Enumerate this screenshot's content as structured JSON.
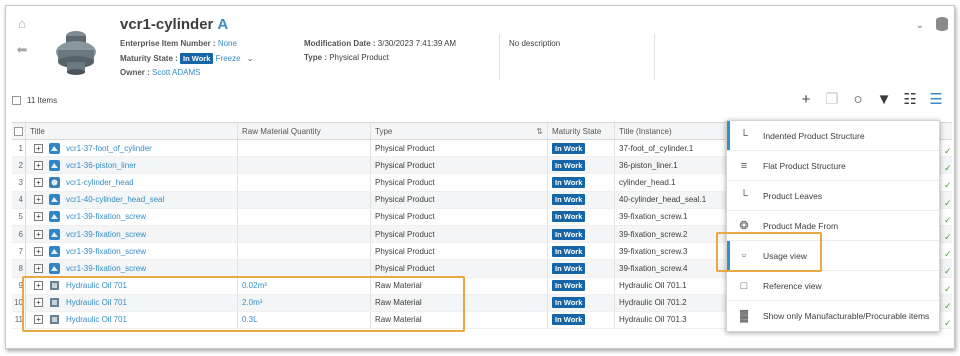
{
  "header": {
    "title": "vcr1-cylinder",
    "revision": "A",
    "enterprise_label": "Enterprise Item Number :",
    "enterprise_value": "None",
    "maturity_label": "Maturity State :",
    "maturity_value": "In Work",
    "maturity_action": "Freeze",
    "owner_label": "Owner :",
    "owner_value": "Scott ADAMS",
    "mod_label": "Modification Date :",
    "mod_value": "3/30/2023 7:41:39 AM",
    "type_label": "Type :",
    "type_value": "Physical Product",
    "description": "No description"
  },
  "toolbar": {
    "items_count": "11 Items"
  },
  "table": {
    "columns": [
      "Title",
      "Raw Material Quantity",
      "Type",
      "Maturity State",
      "Title (Instance)"
    ],
    "rows": [
      {
        "n": "1",
        "title": "vcr1-37-foot_of_cylinder",
        "raw": "",
        "type": "Physical Product",
        "state": "In Work",
        "inst": "37-foot_of_cylinder.1",
        "icon": "part"
      },
      {
        "n": "2",
        "title": "vcr1-36-piston_liner",
        "raw": "",
        "type": "Physical Product",
        "state": "In Work",
        "inst": "36-piston_liner.1",
        "icon": "part"
      },
      {
        "n": "3",
        "title": "vcr1-cylinder_head",
        "raw": "",
        "type": "Physical Product",
        "state": "In Work",
        "inst": "cylinder_head.1",
        "icon": "assembly"
      },
      {
        "n": "4",
        "title": "vcr1-40-cylinder_head_seal",
        "raw": "",
        "type": "Physical Product",
        "state": "In Work",
        "inst": "40-cylinder_head_seal.1",
        "icon": "part"
      },
      {
        "n": "5",
        "title": "vcr1-39-fixation_screw",
        "raw": "",
        "type": "Physical Product",
        "state": "In Work",
        "inst": "39-fixation_screw.1",
        "icon": "part"
      },
      {
        "n": "6",
        "title": "vcr1-39-fixation_screw",
        "raw": "",
        "type": "Physical Product",
        "state": "In Work",
        "inst": "39-fixation_screw.2",
        "icon": "part"
      },
      {
        "n": "7",
        "title": "vcr1-39-fixation_screw",
        "raw": "",
        "type": "Physical Product",
        "state": "In Work",
        "inst": "39-fixation_screw.3",
        "icon": "part"
      },
      {
        "n": "8",
        "title": "vcr1-39-fixation_screw",
        "raw": "",
        "type": "Physical Product",
        "state": "In Work",
        "inst": "39-fixation_screw.4",
        "icon": "part"
      },
      {
        "n": "9",
        "title": "Hydraulic Oil 701",
        "raw": "0.02m³",
        "type": "Raw Material",
        "state": "In Work",
        "inst": "Hydraulic Oil 701.1",
        "icon": "material"
      },
      {
        "n": "10",
        "title": "Hydraulic Oil 701",
        "raw": "2.0m³",
        "type": "Raw Material",
        "state": "In Work",
        "inst": "Hydraulic Oil 701.2",
        "icon": "material"
      },
      {
        "n": "11",
        "title": "Hydraulic Oil 701",
        "raw": "0.3L",
        "type": "Raw Material",
        "state": "In Work",
        "inst": "Hydraulic Oil 701.3",
        "icon": "material"
      }
    ]
  },
  "menu": {
    "items": [
      {
        "label": "Indented Product Structure",
        "icon": "indented-structure-icon",
        "selected": true
      },
      {
        "label": "Flat Product Structure",
        "icon": "flat-structure-icon",
        "selected": false
      },
      {
        "label": "Product Leaves",
        "icon": "leaves-icon",
        "selected": false
      },
      {
        "label": "Product Made From",
        "icon": "made-from-icon",
        "selected": false
      },
      {
        "label": "Usage view",
        "icon": "usage-view-icon",
        "selected": true
      },
      {
        "label": "Reference view",
        "icon": "reference-view-icon",
        "selected": false
      },
      {
        "label": "Show only Manufacturable/Procurable items",
        "icon": "manufacturable-icon",
        "selected": false
      }
    ]
  },
  "colors": {
    "accent": "#368ec4",
    "badge": "#1565a7",
    "highlight": "#e8a844",
    "check": "#4a9a3a"
  }
}
